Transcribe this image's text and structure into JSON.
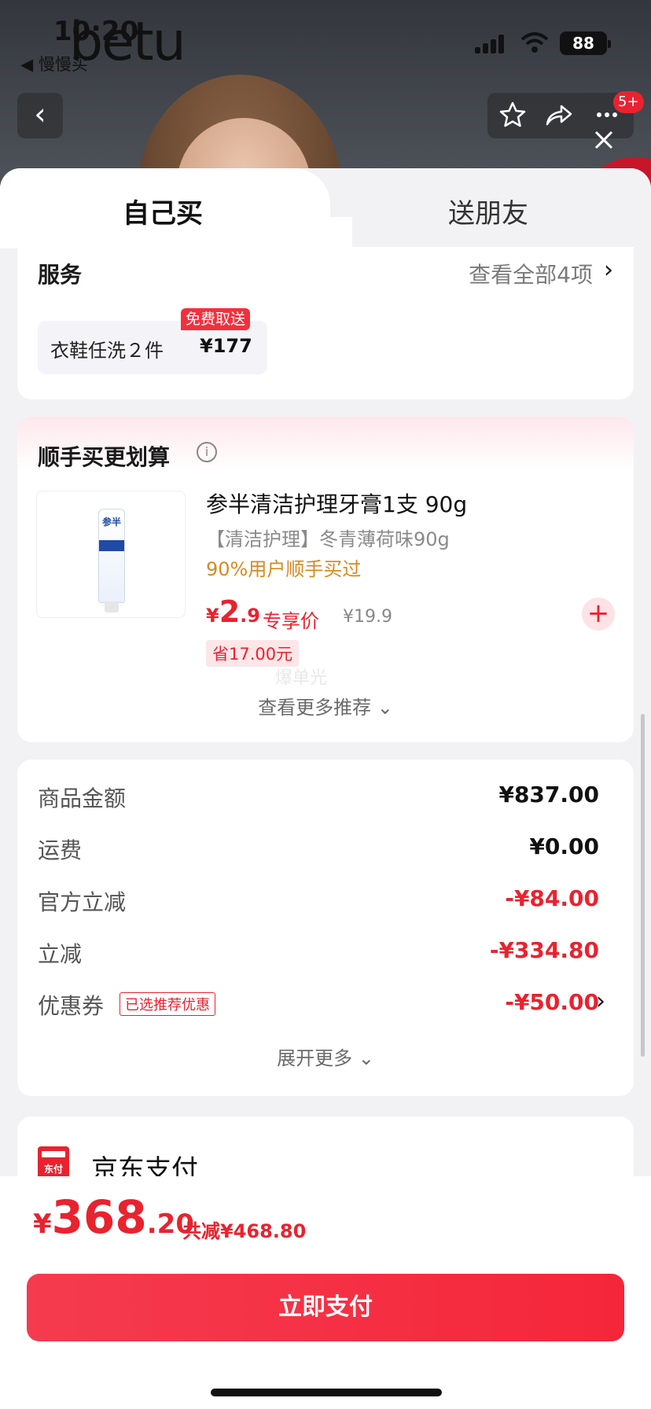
{
  "status": {
    "time": "10:20",
    "brand": "betu",
    "back_app": "◀ 慢慢买",
    "battery": "88"
  },
  "nav": {
    "back_icon": "‹",
    "badge": "5+"
  },
  "tabs": {
    "self": "自己买",
    "gift": "送朋友"
  },
  "services": {
    "title": "服务",
    "more": "查看全部4项",
    "item_name": "衣鞋任洗２件",
    "item_price": "¥177",
    "item_badge": "免费取送"
  },
  "recommend": {
    "title": "顺手买更划算",
    "product": {
      "name": "参半清洁护理牙膏1支 90g",
      "spec": "【清洁护理】冬青薄荷味90g",
      "rate": "90%用户顺手买过",
      "price_currency": "¥",
      "price_int": "2",
      "price_dec": ".9",
      "price_tag": "专享价",
      "original_price": "¥19.9",
      "save": "省17.00元",
      "image_logo": "参半"
    },
    "watermark": "爆单光",
    "more": "查看更多推荐 ⌄"
  },
  "summary": {
    "rows": [
      {
        "label": "商品金额",
        "value": "¥837.00"
      },
      {
        "label": "运费",
        "value": "¥0.00"
      },
      {
        "label": "官方立减",
        "value": "-¥84.00"
      },
      {
        "label": "立减",
        "value": "-¥334.80"
      },
      {
        "label": "优惠券",
        "value": "-¥50.00",
        "tag": "已选推荐优惠"
      }
    ],
    "more": "展开更多 ⌄"
  },
  "payment": {
    "icon_text": "东付",
    "label": "京东支付"
  },
  "bottom": {
    "currency": "¥",
    "total_int": "368",
    "total_dec": ".20",
    "saved": "共减¥468.80",
    "pay_button": "立即支付"
  },
  "colors": {
    "accent": "#e8232f",
    "orange": "#d78a1f"
  }
}
